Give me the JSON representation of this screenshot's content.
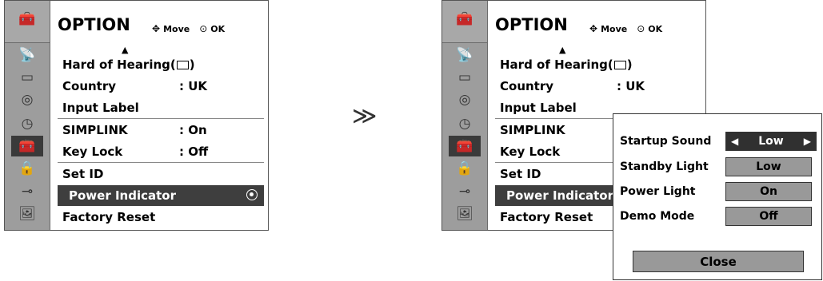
{
  "menu": {
    "title": "OPTION",
    "hint_move": "Move",
    "hint_ok": "OK",
    "hint_move_icon": "four-way-arrow-icon",
    "hint_ok_icon": "ok-circle-icon",
    "scroll_up": "▲",
    "items": [
      {
        "label_pre": "Hard of Hearing(",
        "label_post": ")",
        "value": ""
      },
      {
        "label": "Country",
        "value": ": UK"
      },
      {
        "label": "Input Label",
        "value": ""
      },
      {
        "label": "SIMPLINK",
        "value": ": On"
      },
      {
        "label": "Key Lock",
        "value": ": Off"
      },
      {
        "label": "Set ID",
        "value": ""
      },
      {
        "label": "Power Indicator",
        "value": ""
      },
      {
        "label": "Factory Reset",
        "value": ""
      }
    ],
    "sidebar_icons": [
      "option-toolbox-icon",
      "satellite-dish-icon",
      "picture-screen-icon",
      "audio-speaker-icon",
      "clock-icon",
      "option-toolbox-icon",
      "lock-icon",
      "input-plug-icon",
      "usb-photo-icon"
    ],
    "selected_item": "Power Indicator"
  },
  "transition_glyph": "≫",
  "popup": {
    "rows": [
      {
        "label": "Startup Sound",
        "value": "Low",
        "left_arrow": "◀",
        "right_arrow": "▶"
      },
      {
        "label": "Standby Light",
        "value": "Low"
      },
      {
        "label": "Power Light",
        "value": "On"
      },
      {
        "label": "Demo Mode",
        "value": "Off"
      }
    ],
    "close_label": "Close"
  }
}
